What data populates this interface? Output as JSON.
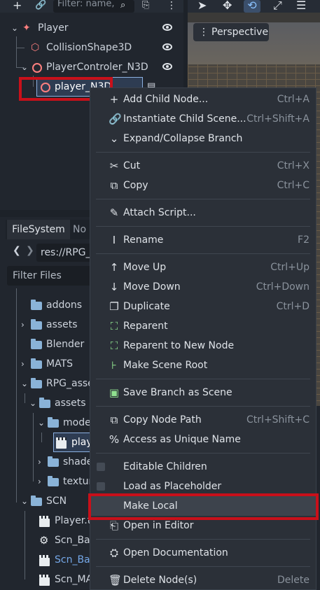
{
  "scene_dock": {
    "filter_placeholder": "Filter: name,",
    "tree": [
      {
        "label": "Player",
        "icon": "player-node-icon",
        "color": "#fc7f7f"
      },
      {
        "label": "CollisionShape3D",
        "icon": "collision-shape-icon",
        "color": "#fc7f7f"
      },
      {
        "label": "PlayerControler_N3D",
        "icon": "node3d-icon",
        "color": "#fc7f7f"
      },
      {
        "label": "player_N3D",
        "icon": "node3d-icon",
        "color": "#fc7f7f"
      }
    ]
  },
  "viewport": {
    "perspective_label": "Perspective"
  },
  "filesystem": {
    "tab_label": "FileSystem",
    "tab2_label": "No",
    "path": "res://RPG_a",
    "filter_placeholder": "Filter Files",
    "items": [
      {
        "label": "addons",
        "type": "folder"
      },
      {
        "label": "assets",
        "type": "folder"
      },
      {
        "label": "Blender",
        "type": "folder"
      },
      {
        "label": "MATS",
        "type": "folder"
      },
      {
        "label": "RPG_asse",
        "type": "folder"
      },
      {
        "label": "assets",
        "type": "folder"
      },
      {
        "label": "mode",
        "type": "folder"
      },
      {
        "label": "play",
        "type": "scene"
      },
      {
        "label": "shade",
        "type": "folder"
      },
      {
        "label": "textur",
        "type": "folder"
      },
      {
        "label": "SCN",
        "type": "folder"
      },
      {
        "label": "Player.ts",
        "type": "scene"
      },
      {
        "label": "Scn_Bas",
        "type": "gear"
      },
      {
        "label": "Scn_Bas",
        "type": "scene",
        "color": "#75a8e8"
      },
      {
        "label": "Scn_MA",
        "type": "scene"
      }
    ]
  },
  "context_menu": {
    "items": [
      {
        "label": "Add Child Node...",
        "shortcut": "Ctrl+A",
        "icon": "plus-icon"
      },
      {
        "label": "Instantiate Child Scene...",
        "shortcut": "Ctrl+Shift+A",
        "icon": "link-icon"
      },
      {
        "label": "Expand/Collapse Branch",
        "shortcut": "",
        "icon": "chevron-down-icon"
      },
      {
        "label": "Cut",
        "shortcut": "Ctrl+X",
        "icon": "scissors-icon"
      },
      {
        "label": "Copy",
        "shortcut": "Ctrl+C",
        "icon": "copy-icon"
      },
      {
        "label": "Attach Script...",
        "shortcut": "",
        "icon": "script-icon"
      },
      {
        "label": "Rename",
        "shortcut": "F2",
        "icon": "text-cursor-icon"
      },
      {
        "label": "Move Up",
        "shortcut": "Ctrl+Up",
        "icon": "arrow-up-icon"
      },
      {
        "label": "Move Down",
        "shortcut": "Ctrl+Down",
        "icon": "arrow-down-icon"
      },
      {
        "label": "Duplicate",
        "shortcut": "Ctrl+D",
        "icon": "duplicate-icon"
      },
      {
        "label": "Reparent",
        "shortcut": "",
        "icon": "reparent-icon"
      },
      {
        "label": "Reparent to New Node",
        "shortcut": "",
        "icon": "reparent-new-icon"
      },
      {
        "label": "Make Scene Root",
        "shortcut": "",
        "icon": "scene-root-icon"
      },
      {
        "label": "Save Branch as Scene",
        "shortcut": "",
        "icon": "save-branch-icon"
      },
      {
        "label": "Copy Node Path",
        "shortcut": "Ctrl+Shift+C",
        "icon": "copy-path-icon"
      },
      {
        "label": "Access as Unique Name",
        "shortcut": "",
        "icon": "percent-icon"
      },
      {
        "label": "Editable Children",
        "shortcut": "",
        "icon": "checkbox-icon"
      },
      {
        "label": "Load as Placeholder",
        "shortcut": "",
        "icon": "checkbox-icon"
      },
      {
        "label": "Make Local",
        "shortcut": "",
        "icon": ""
      },
      {
        "label": "Open in Editor",
        "shortcut": "",
        "icon": "open-editor-icon"
      },
      {
        "label": "Open Documentation",
        "shortcut": "",
        "icon": "doc-icon"
      },
      {
        "label": "Delete Node(s)",
        "shortcut": "Delete",
        "icon": "trash-icon"
      }
    ]
  },
  "colors": {
    "highlight_red": "#c8101a",
    "node_red": "#fc7f7f",
    "folder_blue": "#8ab3d8",
    "link_blue": "#75a8e8"
  }
}
